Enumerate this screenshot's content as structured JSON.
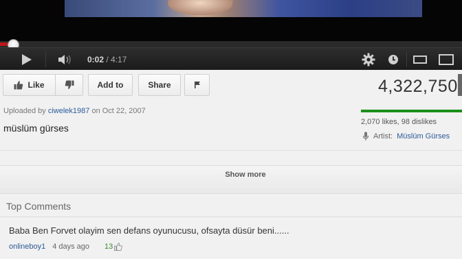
{
  "player": {
    "current_time": "0:02",
    "separator": " / ",
    "duration": "4:17",
    "progress_fraction": 0.008
  },
  "actions": {
    "like_label": "Like",
    "add_to_label": "Add to",
    "share_label": "Share"
  },
  "stats": {
    "view_count": "4,322,750",
    "likes_dislikes": "2,070 likes, 98 dislikes"
  },
  "info": {
    "uploaded_prefix": "Uploaded by",
    "uploader": "ciwelek1987",
    "uploaded_on": "on Oct 22, 2007",
    "video_title": "müslüm gürses",
    "artist_label": "Artist:",
    "artist_name": "Müslüm Gürses",
    "show_more": "Show more"
  },
  "comments": {
    "header": "Top Comments",
    "items": [
      {
        "text": "Baba Ben Forvet olayim sen defans oyunucusu, ofsayta düsür beni......",
        "author": "onlineboy1",
        "age": "4 days ago",
        "votes": "13"
      }
    ]
  },
  "colors": {
    "progress_played": "#c0151b",
    "like_bar": "#1a8f1a",
    "link": "#2b5aa0"
  },
  "icons": [
    "play-icon",
    "volume-icon",
    "gear-icon",
    "clock-icon",
    "small-player-icon",
    "large-player-icon",
    "thumbs-up-icon",
    "thumbs-down-icon",
    "flag-icon",
    "microphone-icon"
  ]
}
